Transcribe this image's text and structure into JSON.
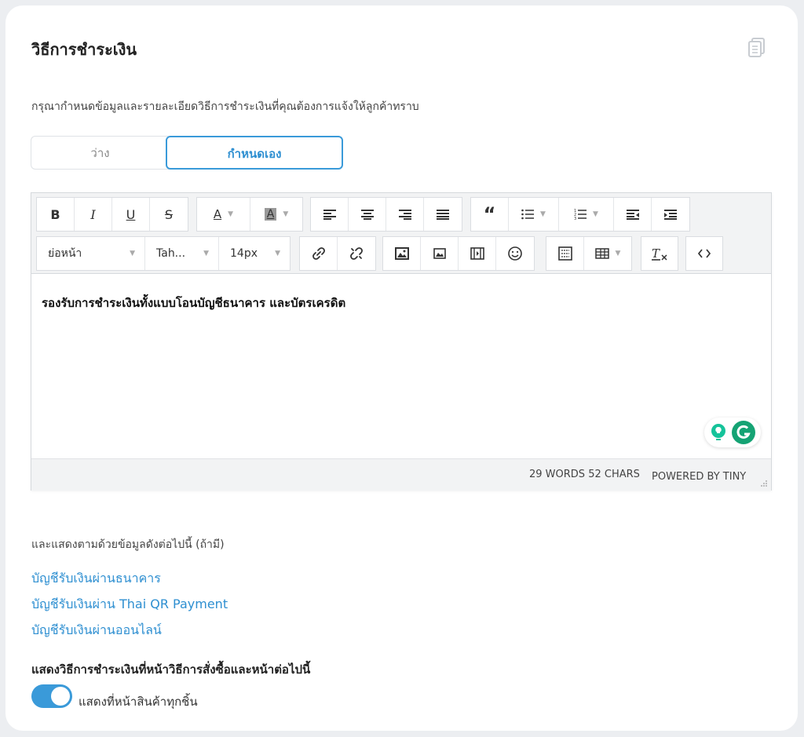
{
  "page": {
    "title": "วิธีการชำระเงิน",
    "description": "กรุณากำหนดข้อมูลและรายละเอียดวิธีการชำระเงินที่คุณต้องการแจ้งให้ลูกค้าทราบ",
    "copy_icon": "copy-icon"
  },
  "mode_switch": {
    "options": [
      "ว่าง",
      "กำหนดเอง"
    ],
    "selected": "กำหนดเอง"
  },
  "editor": {
    "toolbar": {
      "bold": "B",
      "italic": "I",
      "underline": "U",
      "strike": "S",
      "text_color": "A",
      "bg_color": "A",
      "blocks_value": "ย่อหน้า",
      "font_family_value": "Tah...",
      "font_size_value": "14px",
      "icons": [
        "align-left-icon",
        "align-center-icon",
        "align-right-icon",
        "align-justify-icon",
        "blockquote-icon",
        "bullet-list-icon",
        "numbered-list-icon",
        "outdent-icon",
        "indent-icon",
        "link-icon",
        "unlink-icon",
        "image-icon",
        "image-icon",
        "media-icon",
        "emoticon-icon",
        "template-icon",
        "table-icon",
        "clear-format-icon",
        "code-icon"
      ]
    },
    "content": "รองรับการชำระเงินทั้งแบบโอนบัญชีธนาคาร และบัตรเครดิต",
    "word_count": "29 WORDS 52 CHARS",
    "powered_by": "POWERED BY TINY"
  },
  "extra": {
    "label": "และแสดงตามด้วยข้อมูลดังต่อไปนี้ (ถ้ามี)",
    "links": [
      "บัญชีรับเงินผ่านธนาคาร",
      "บัญชีรับเงินผ่าน Thai QR Payment",
      "บัญชีรับเงินผ่านออนไลน์"
    ]
  },
  "display": {
    "heading": "แสดงวิธีการชำระเงินที่หน้าวิธีการสั่งซื้อและหน้าต่อไปนี้",
    "toggle_label": "แสดงที่หน้าสินค้าทุกชิ้น",
    "toggle_on": true
  },
  "colors": {
    "accent": "#3a9ad9",
    "link": "#2e8fd1",
    "toolbar_bg": "#f2f3f4"
  }
}
